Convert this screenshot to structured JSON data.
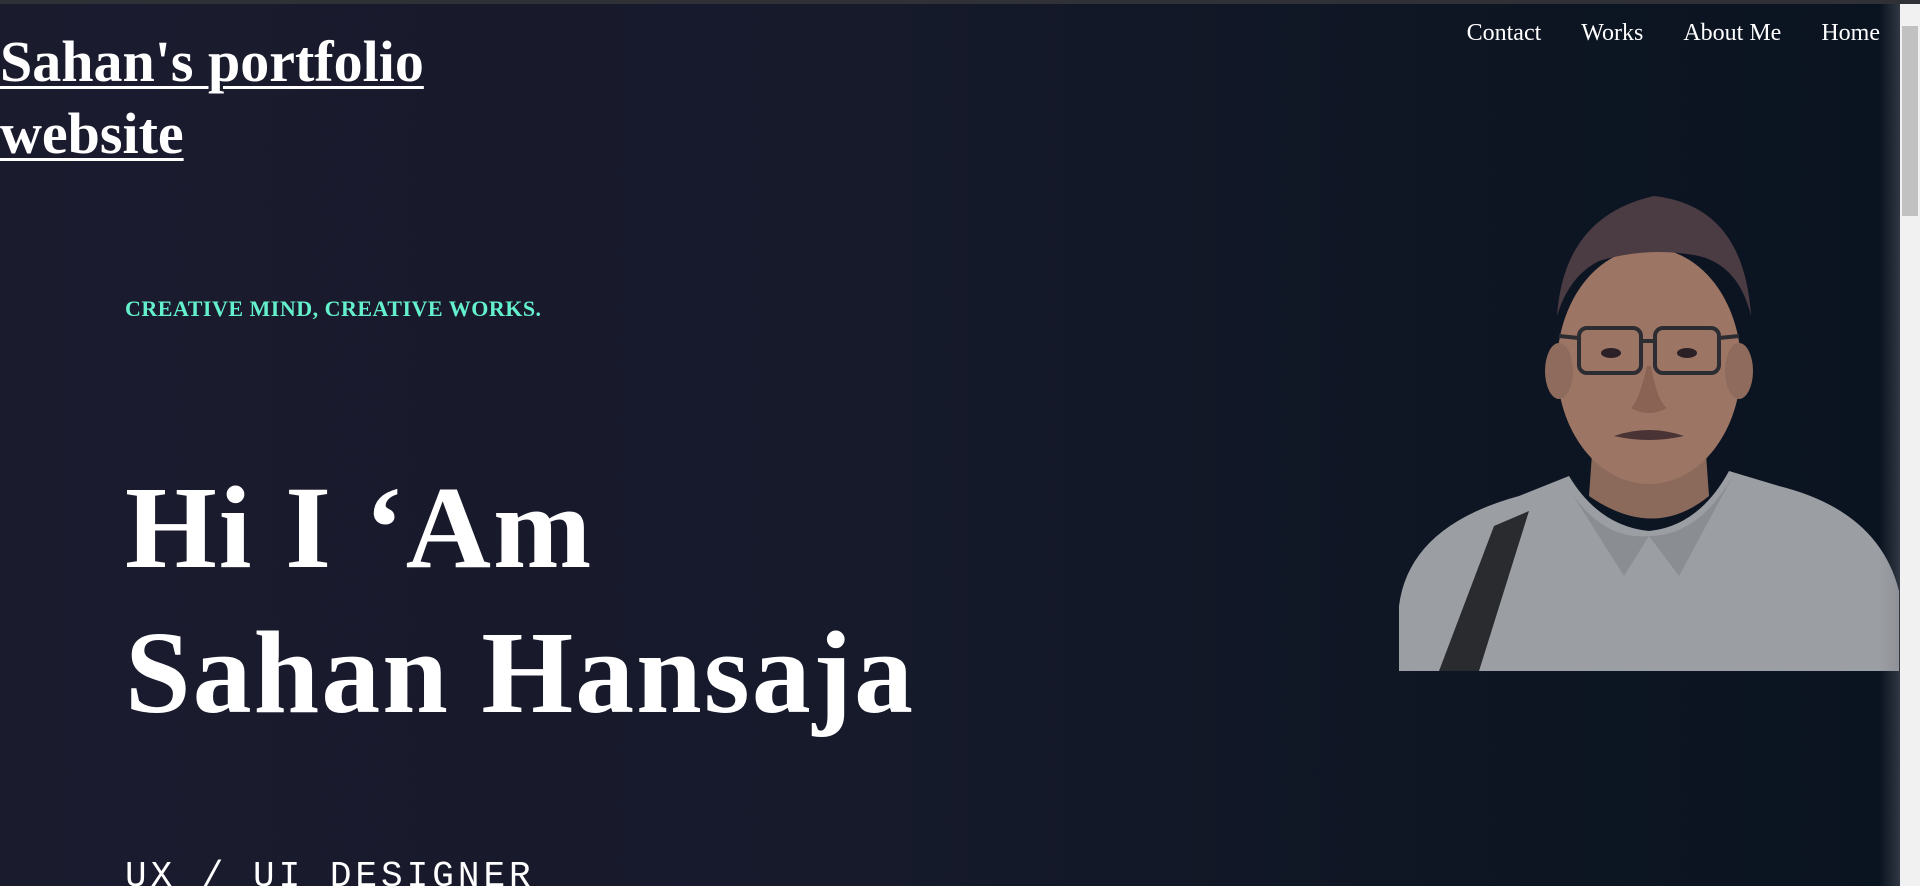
{
  "header": {
    "site_title": "Sahan's portfolio website"
  },
  "nav": {
    "items": [
      "Contact",
      "Works",
      "About Me",
      "Home"
    ]
  },
  "hero": {
    "tagline": "CREATIVE MIND, CREATIVE WORKS.",
    "headline_line1": "Hi I ‘Am",
    "headline_line2": "Sahan Hansaja",
    "role": "UX / UI DESIGNER"
  },
  "colors": {
    "accent": "#64f0cc",
    "background_left": "#1b1b2e",
    "background_right": "#0a1420"
  }
}
